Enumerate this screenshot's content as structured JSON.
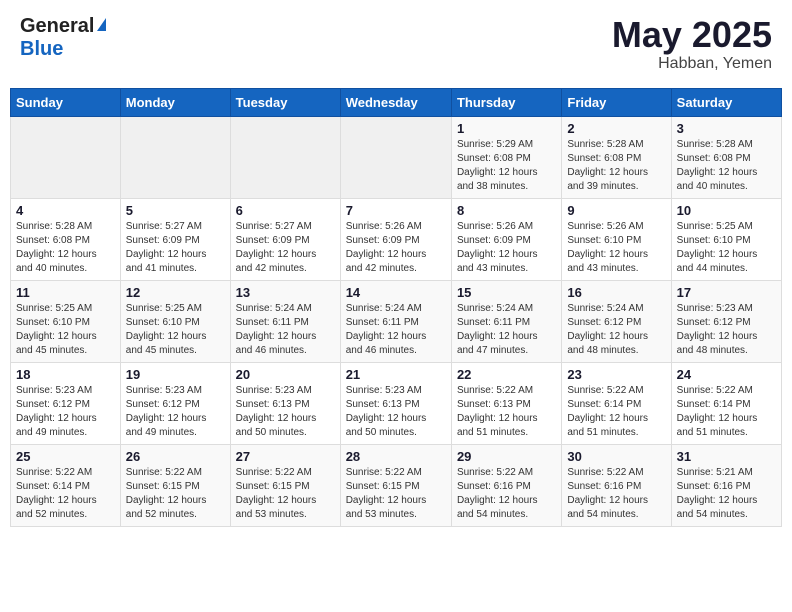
{
  "header": {
    "logo_general": "General",
    "logo_blue": "Blue",
    "month_year": "May 2025",
    "location": "Habban, Yemen"
  },
  "weekdays": [
    "Sunday",
    "Monday",
    "Tuesday",
    "Wednesday",
    "Thursday",
    "Friday",
    "Saturday"
  ],
  "weeks": [
    [
      {
        "day": "",
        "info": ""
      },
      {
        "day": "",
        "info": ""
      },
      {
        "day": "",
        "info": ""
      },
      {
        "day": "",
        "info": ""
      },
      {
        "day": "1",
        "info": "Sunrise: 5:29 AM\nSunset: 6:08 PM\nDaylight: 12 hours\nand 38 minutes."
      },
      {
        "day": "2",
        "info": "Sunrise: 5:28 AM\nSunset: 6:08 PM\nDaylight: 12 hours\nand 39 minutes."
      },
      {
        "day": "3",
        "info": "Sunrise: 5:28 AM\nSunset: 6:08 PM\nDaylight: 12 hours\nand 40 minutes."
      }
    ],
    [
      {
        "day": "4",
        "info": "Sunrise: 5:28 AM\nSunset: 6:08 PM\nDaylight: 12 hours\nand 40 minutes."
      },
      {
        "day": "5",
        "info": "Sunrise: 5:27 AM\nSunset: 6:09 PM\nDaylight: 12 hours\nand 41 minutes."
      },
      {
        "day": "6",
        "info": "Sunrise: 5:27 AM\nSunset: 6:09 PM\nDaylight: 12 hours\nand 42 minutes."
      },
      {
        "day": "7",
        "info": "Sunrise: 5:26 AM\nSunset: 6:09 PM\nDaylight: 12 hours\nand 42 minutes."
      },
      {
        "day": "8",
        "info": "Sunrise: 5:26 AM\nSunset: 6:09 PM\nDaylight: 12 hours\nand 43 minutes."
      },
      {
        "day": "9",
        "info": "Sunrise: 5:26 AM\nSunset: 6:10 PM\nDaylight: 12 hours\nand 43 minutes."
      },
      {
        "day": "10",
        "info": "Sunrise: 5:25 AM\nSunset: 6:10 PM\nDaylight: 12 hours\nand 44 minutes."
      }
    ],
    [
      {
        "day": "11",
        "info": "Sunrise: 5:25 AM\nSunset: 6:10 PM\nDaylight: 12 hours\nand 45 minutes."
      },
      {
        "day": "12",
        "info": "Sunrise: 5:25 AM\nSunset: 6:10 PM\nDaylight: 12 hours\nand 45 minutes."
      },
      {
        "day": "13",
        "info": "Sunrise: 5:24 AM\nSunset: 6:11 PM\nDaylight: 12 hours\nand 46 minutes."
      },
      {
        "day": "14",
        "info": "Sunrise: 5:24 AM\nSunset: 6:11 PM\nDaylight: 12 hours\nand 46 minutes."
      },
      {
        "day": "15",
        "info": "Sunrise: 5:24 AM\nSunset: 6:11 PM\nDaylight: 12 hours\nand 47 minutes."
      },
      {
        "day": "16",
        "info": "Sunrise: 5:24 AM\nSunset: 6:12 PM\nDaylight: 12 hours\nand 48 minutes."
      },
      {
        "day": "17",
        "info": "Sunrise: 5:23 AM\nSunset: 6:12 PM\nDaylight: 12 hours\nand 48 minutes."
      }
    ],
    [
      {
        "day": "18",
        "info": "Sunrise: 5:23 AM\nSunset: 6:12 PM\nDaylight: 12 hours\nand 49 minutes."
      },
      {
        "day": "19",
        "info": "Sunrise: 5:23 AM\nSunset: 6:12 PM\nDaylight: 12 hours\nand 49 minutes."
      },
      {
        "day": "20",
        "info": "Sunrise: 5:23 AM\nSunset: 6:13 PM\nDaylight: 12 hours\nand 50 minutes."
      },
      {
        "day": "21",
        "info": "Sunrise: 5:23 AM\nSunset: 6:13 PM\nDaylight: 12 hours\nand 50 minutes."
      },
      {
        "day": "22",
        "info": "Sunrise: 5:22 AM\nSunset: 6:13 PM\nDaylight: 12 hours\nand 51 minutes."
      },
      {
        "day": "23",
        "info": "Sunrise: 5:22 AM\nSunset: 6:14 PM\nDaylight: 12 hours\nand 51 minutes."
      },
      {
        "day": "24",
        "info": "Sunrise: 5:22 AM\nSunset: 6:14 PM\nDaylight: 12 hours\nand 51 minutes."
      }
    ],
    [
      {
        "day": "25",
        "info": "Sunrise: 5:22 AM\nSunset: 6:14 PM\nDaylight: 12 hours\nand 52 minutes."
      },
      {
        "day": "26",
        "info": "Sunrise: 5:22 AM\nSunset: 6:15 PM\nDaylight: 12 hours\nand 52 minutes."
      },
      {
        "day": "27",
        "info": "Sunrise: 5:22 AM\nSunset: 6:15 PM\nDaylight: 12 hours\nand 53 minutes."
      },
      {
        "day": "28",
        "info": "Sunrise: 5:22 AM\nSunset: 6:15 PM\nDaylight: 12 hours\nand 53 minutes."
      },
      {
        "day": "29",
        "info": "Sunrise: 5:22 AM\nSunset: 6:16 PM\nDaylight: 12 hours\nand 54 minutes."
      },
      {
        "day": "30",
        "info": "Sunrise: 5:22 AM\nSunset: 6:16 PM\nDaylight: 12 hours\nand 54 minutes."
      },
      {
        "day": "31",
        "info": "Sunrise: 5:21 AM\nSunset: 6:16 PM\nDaylight: 12 hours\nand 54 minutes."
      }
    ]
  ]
}
